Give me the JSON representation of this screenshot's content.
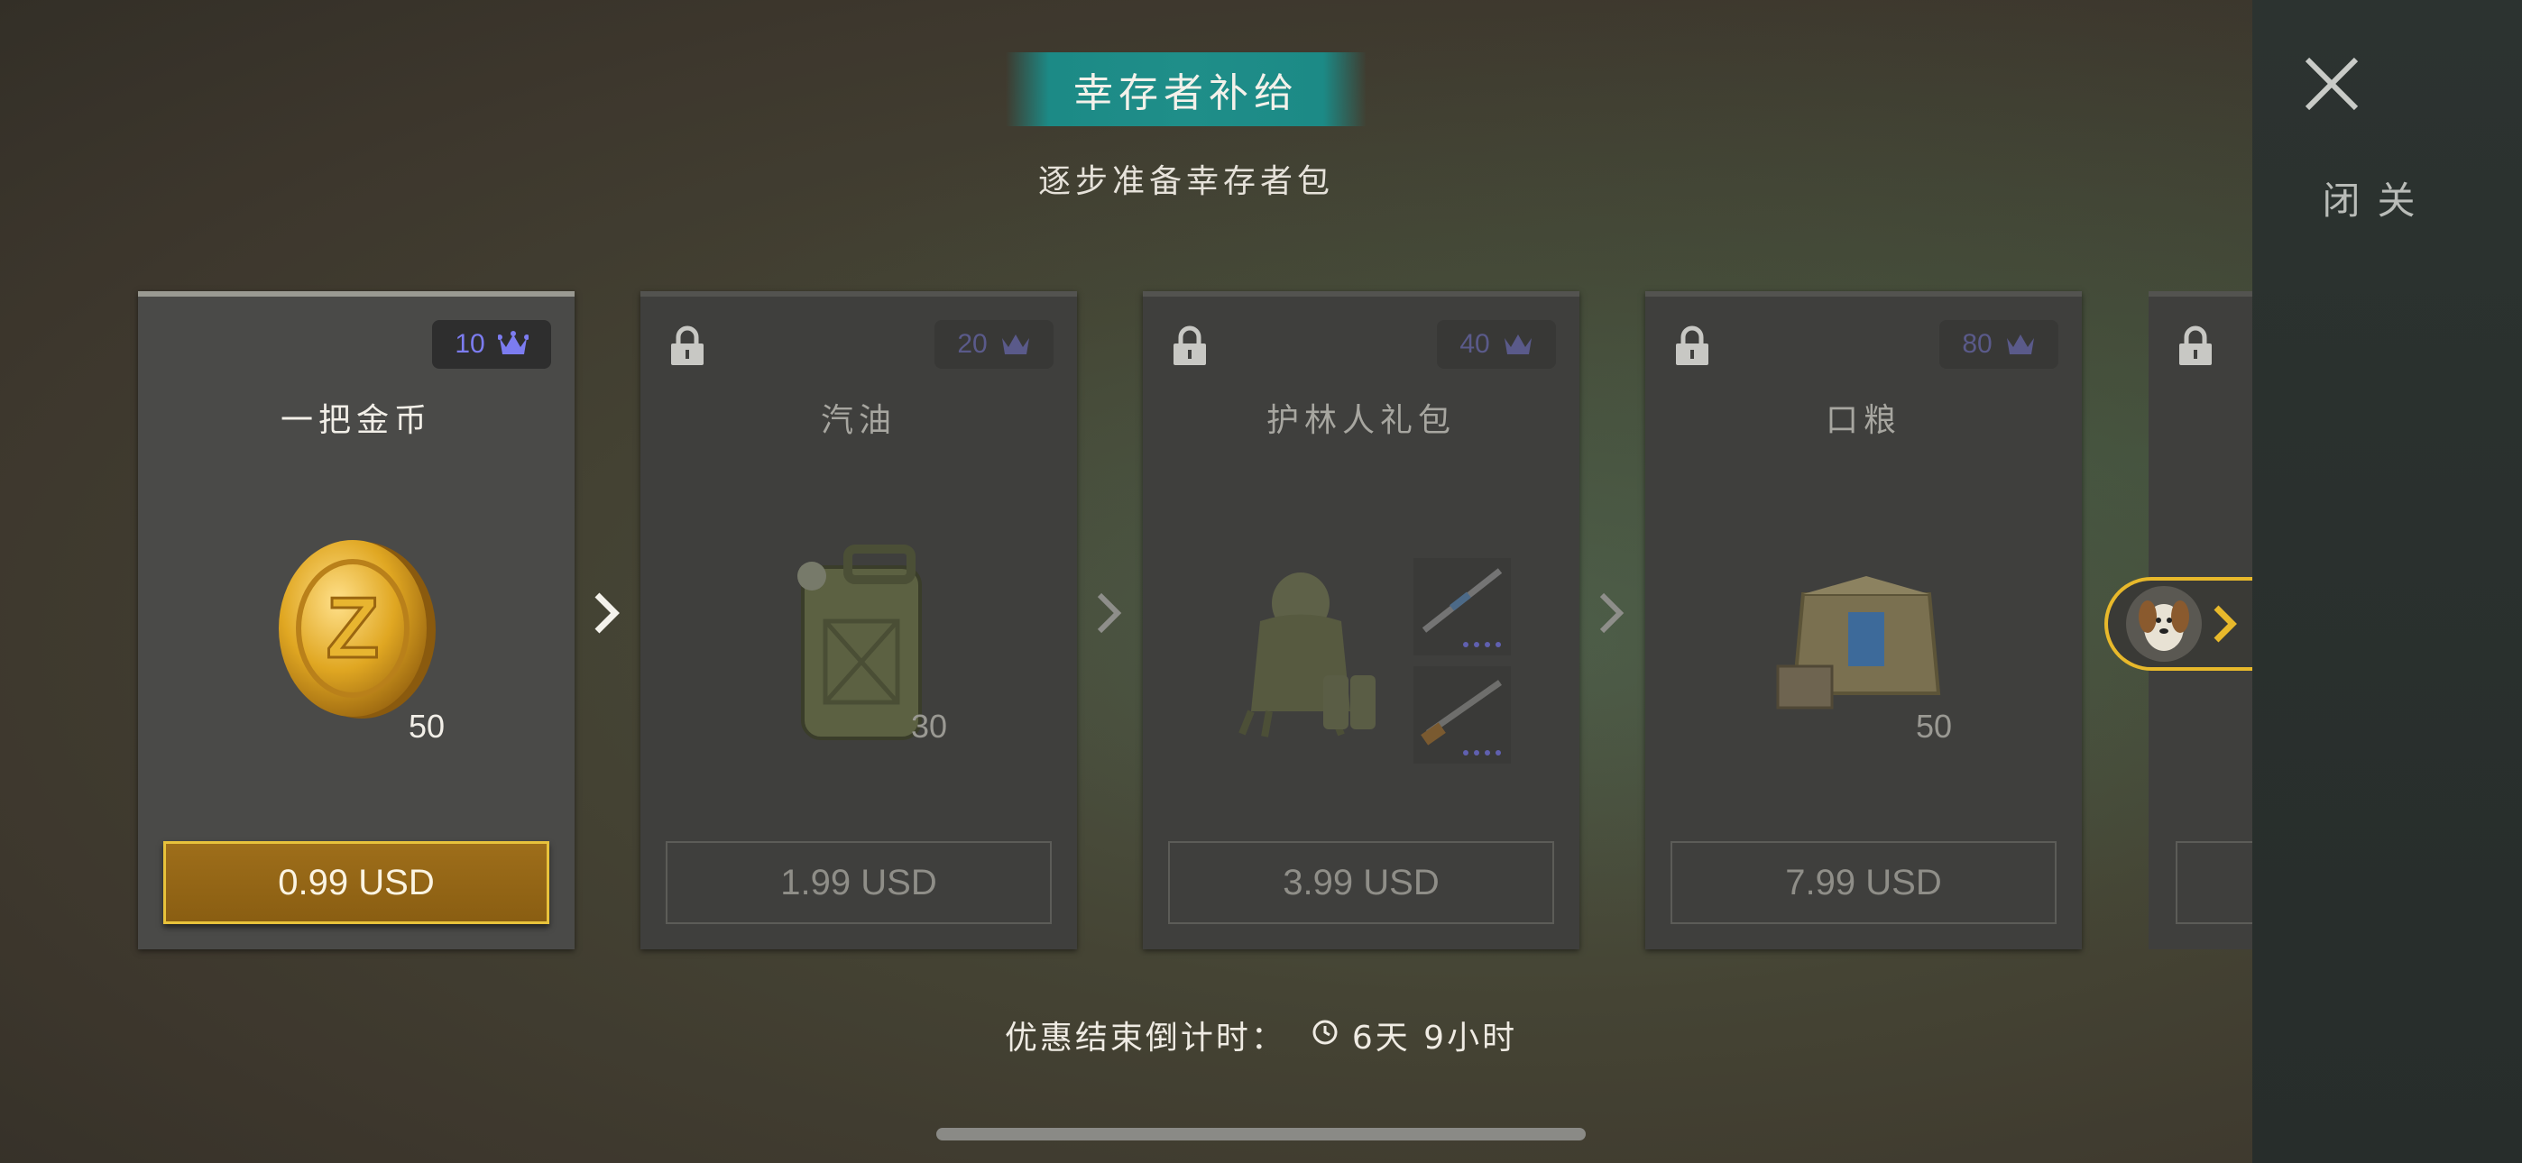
{
  "header": {
    "title": "幸存者补给",
    "subtitle": "逐步准备幸存者包"
  },
  "close": {
    "label": "关闭",
    "icon": "close-icon"
  },
  "cards": [
    {
      "title": "一把金币",
      "crown_points": "10",
      "quantity": "50",
      "price": "0.99 USD",
      "locked": false,
      "item_icon": "gold-coin-icon"
    },
    {
      "title": "汽油",
      "crown_points": "20",
      "quantity": "30",
      "price": "1.99 USD",
      "locked": true,
      "item_icon": "jerrycan-icon"
    },
    {
      "title": "护林人礼包",
      "crown_points": "40",
      "quantity": "",
      "price": "3.99 USD",
      "locked": true,
      "item_icon": "ghillie-suit-icon"
    },
    {
      "title": "口粮",
      "crown_points": "80",
      "quantity": "50",
      "price": "7.99 USD",
      "locked": true,
      "item_icon": "ration-crate-icon"
    }
  ],
  "countdown": {
    "label": "优惠结束倒计时：",
    "time": "6天 9小时"
  },
  "colors": {
    "accent_teal": "#1f8e89",
    "gold": "#e8c23b",
    "crown": "#7c7cf0"
  }
}
